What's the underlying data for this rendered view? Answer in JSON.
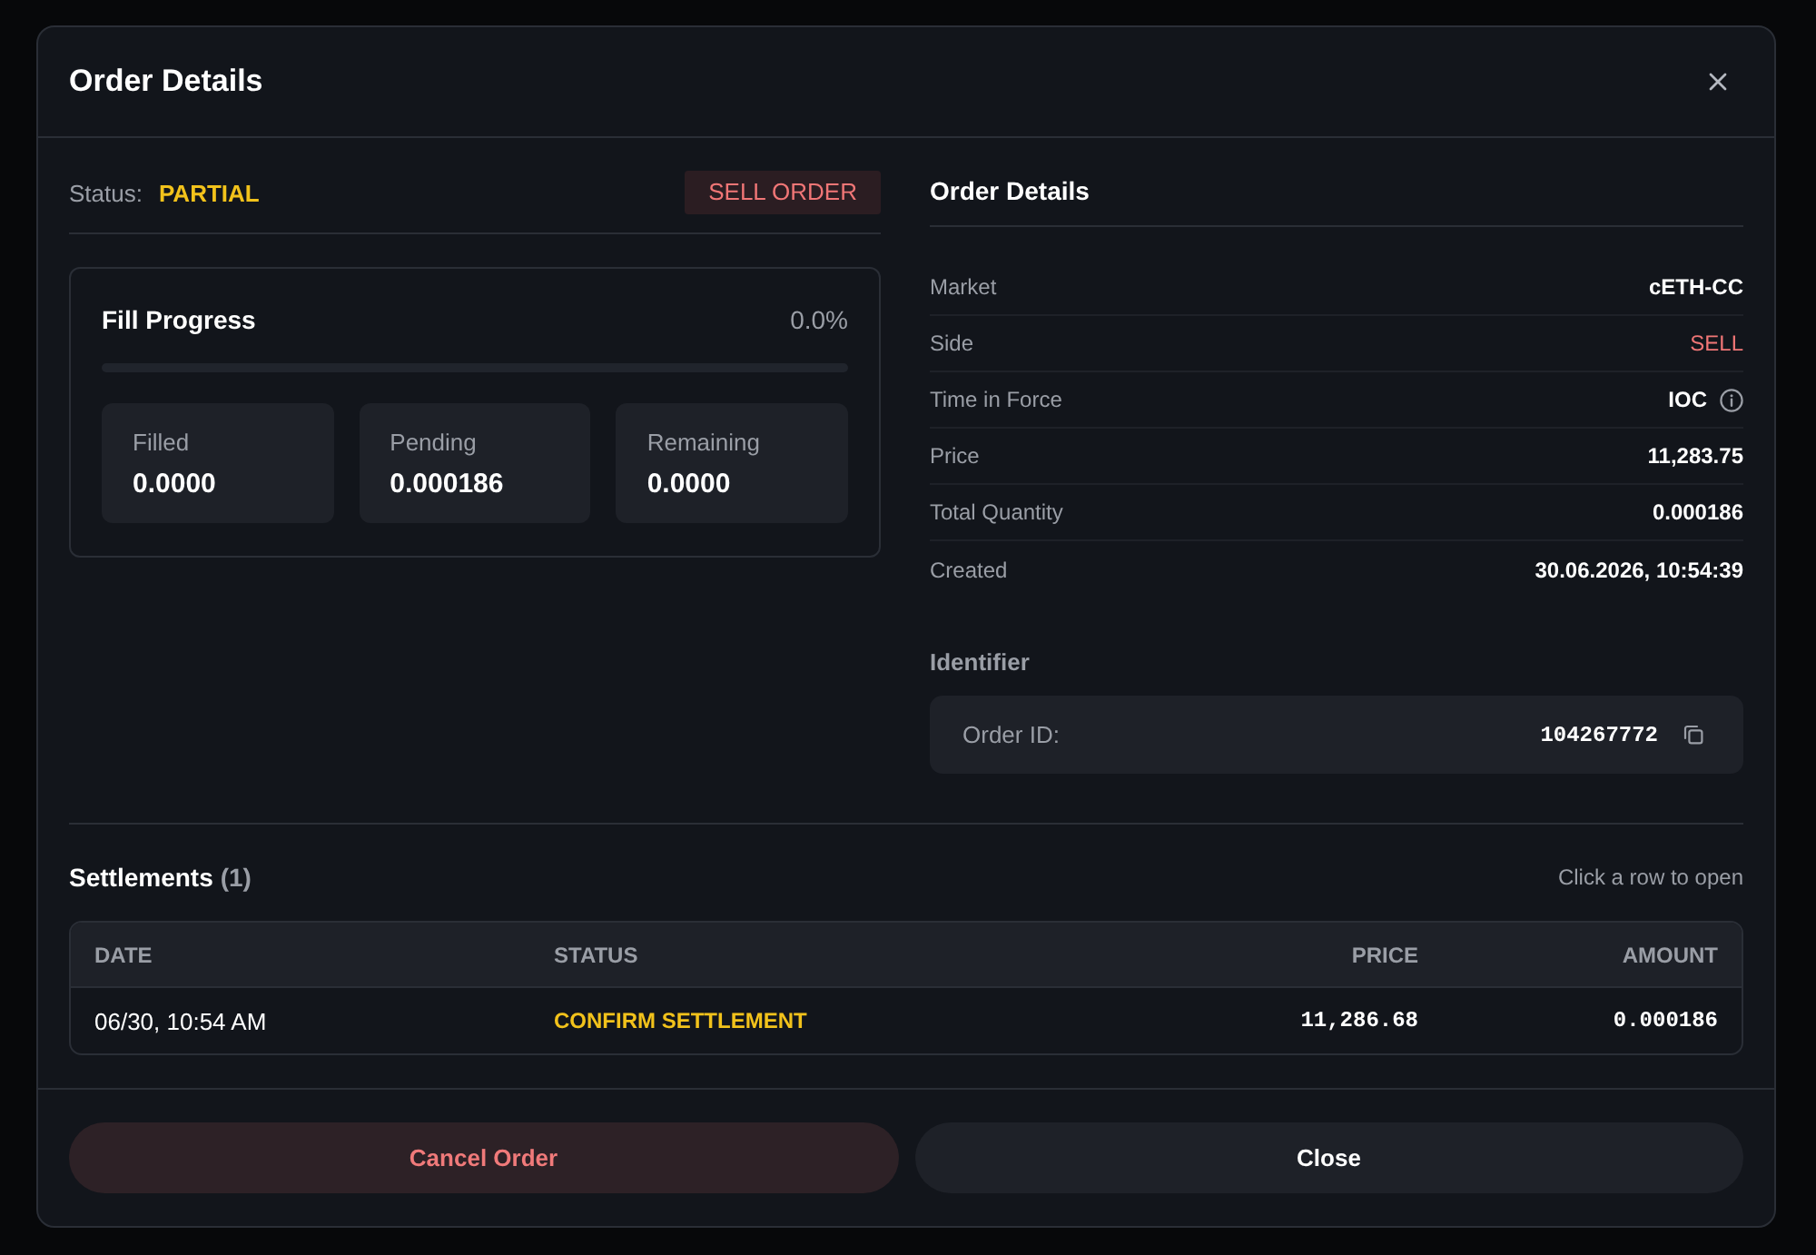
{
  "dialog": {
    "title": "Order Details"
  },
  "status": {
    "label": "Status:",
    "value": "PARTIAL",
    "badge": "SELL ORDER"
  },
  "fill_progress": {
    "title": "Fill Progress",
    "percent": "0.0%",
    "level": 0,
    "stats": [
      {
        "label": "Filled",
        "value": "0.0000"
      },
      {
        "label": "Pending",
        "value": "0.000186"
      },
      {
        "label": "Remaining",
        "value": "0.0000"
      }
    ]
  },
  "details": {
    "title": "Order Details",
    "rows": [
      {
        "label": "Market",
        "value": "cETH-CC",
        "kind": "plain"
      },
      {
        "label": "Side",
        "value": "SELL",
        "kind": "sell"
      },
      {
        "label": "Time in Force",
        "value": "IOC",
        "kind": "info"
      },
      {
        "label": "Price",
        "value": "11,283.75",
        "kind": "plain"
      },
      {
        "label": "Total Quantity",
        "value": "0.000186",
        "kind": "plain"
      },
      {
        "label": "Created",
        "value": "30.06.2026, 10:54:39",
        "kind": "plain"
      }
    ]
  },
  "identifier": {
    "title": "Identifier",
    "label": "Order ID:",
    "value": "104267772"
  },
  "settlements": {
    "title": "Settlements",
    "count": "(1)",
    "hint": "Click a row to open",
    "columns": [
      "DATE",
      "STATUS",
      "PRICE",
      "AMOUNT"
    ],
    "rows": [
      {
        "date": "06/30, 10:54 AM",
        "status": "CONFIRM SETTLEMENT",
        "price": "11,286.68",
        "amount": "0.000186"
      }
    ]
  },
  "buttons": [
    {
      "label": "Cancel Order",
      "kind": "danger"
    },
    {
      "label": "Close",
      "kind": "secondary"
    }
  ]
}
